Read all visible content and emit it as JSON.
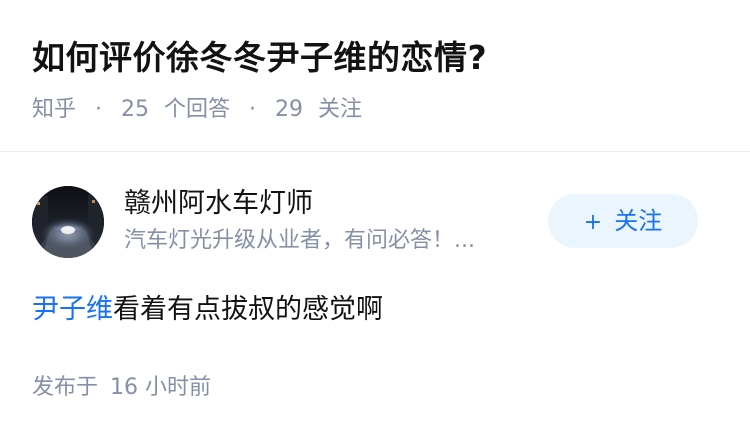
{
  "question": {
    "title": "如何评价徐冬冬尹子维的恋情?",
    "platform": "知乎",
    "separator": "·",
    "answer_count": "25",
    "answer_label": "个回答",
    "follower_count": "29",
    "follower_label": "关注"
  },
  "answer": {
    "author": {
      "name": "赣州阿水车灯师",
      "bio": "汽车灯光升级从业者，有问必答！..."
    },
    "follow_button": {
      "icon": "plus-icon",
      "icon_glyph": "+",
      "label": "关注"
    },
    "content": {
      "link_text": "尹子维",
      "rest_text": "看着有点拔叔的感觉啊"
    },
    "time": {
      "label": "发布于",
      "value": "16 小时前"
    }
  },
  "colors": {
    "accent": "#1772f6",
    "button_bg": "#ebf5fd",
    "meta_text": "#8590a6",
    "primary_text": "#121212",
    "divider": "#ebebeb"
  }
}
